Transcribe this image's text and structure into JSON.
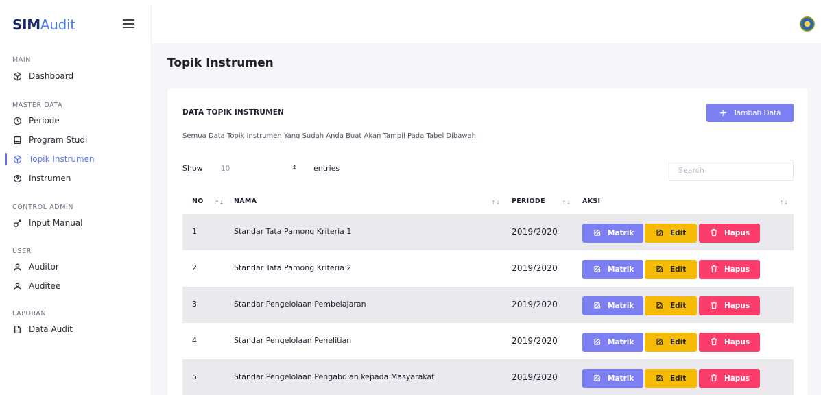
{
  "brand": {
    "bold": "SIM",
    "light": "Audit"
  },
  "sidebar": {
    "sections": [
      {
        "title": "MAIN",
        "items": [
          {
            "label": "Dashboard",
            "icon": "cube-icon",
            "active": false
          }
        ]
      },
      {
        "title": "MASTER DATA",
        "items": [
          {
            "label": "Periode",
            "icon": "clock-icon",
            "active": false
          },
          {
            "label": "Program Studi",
            "icon": "square-icon",
            "active": false
          },
          {
            "label": "Topik Instrumen",
            "icon": "cube-icon",
            "active": true
          },
          {
            "label": "Instrumen",
            "icon": "help-circle-icon",
            "active": false
          }
        ]
      },
      {
        "title": "CONTROL ADMIN",
        "items": [
          {
            "label": "Input Manual",
            "icon": "key-icon",
            "active": false
          }
        ]
      },
      {
        "title": "USER",
        "items": [
          {
            "label": "Auditor",
            "icon": "user-icon",
            "active": false
          },
          {
            "label": "Auditee",
            "icon": "user-icon",
            "active": false
          }
        ]
      },
      {
        "title": "LAPORAN",
        "items": [
          {
            "label": "Data Audit",
            "icon": "file-icon",
            "active": false
          }
        ]
      }
    ]
  },
  "page": {
    "title": "Topik Instrumen"
  },
  "card": {
    "title": "DATA TOPIK INSTRUMEN",
    "subtitle": "Semua Data Topik Instrumen Yang Sudah Anda Buat Akan Tampil Pada Tabel Dibawah.",
    "add_button": "Tambah Data",
    "show_label": "Show",
    "entries_value": "10",
    "entries_label": "entries",
    "search_placeholder": "Search"
  },
  "table": {
    "headers": {
      "no": "NO",
      "nama": "NAMA",
      "periode": "PERIODE",
      "aksi": "AKSI"
    },
    "actions": {
      "matrik": "Matrik",
      "edit": "Edit",
      "hapus": "Hapus"
    },
    "rows": [
      {
        "no": "1",
        "nama": "Standar Tata Pamong Kriteria 1",
        "periode": "2019/2020"
      },
      {
        "no": "2",
        "nama": "Standar Tata Pamong Kriteria 2",
        "periode": "2019/2020"
      },
      {
        "no": "3",
        "nama": "Standar Pengelolaan Pembelajaran",
        "periode": "2019/2020"
      },
      {
        "no": "4",
        "nama": "Standar Pengelolaan Penelitian",
        "periode": "2019/2020"
      },
      {
        "no": "5",
        "nama": "Standar Pengelolaan Pengabdian kepada Masyarakat",
        "periode": "2019/2020"
      }
    ]
  },
  "colors": {
    "accent": "#7b7ff2",
    "edit": "#f6bb07",
    "delete": "#fb3d6b",
    "active_nav": "#5b73e8"
  }
}
